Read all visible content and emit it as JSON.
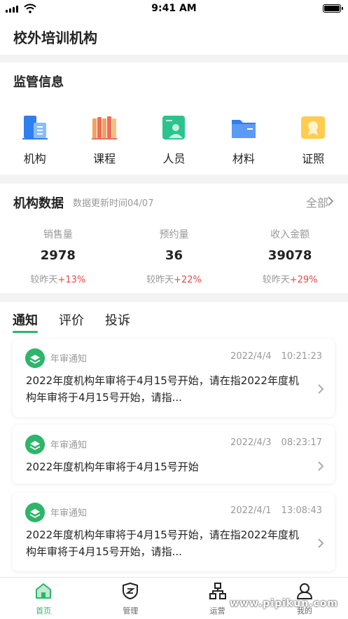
{
  "status_bar": {
    "time": "9:41 AM"
  },
  "header": {
    "title": "校外培训机构"
  },
  "supervision": {
    "title": "监管信息",
    "items": [
      {
        "label": "机构",
        "icon": "building-icon"
      },
      {
        "label": "课程",
        "icon": "books-icon"
      },
      {
        "label": "人员",
        "icon": "person-card-icon"
      },
      {
        "label": "材料",
        "icon": "folder-icon"
      },
      {
        "label": "证照",
        "icon": "certificate-icon"
      }
    ]
  },
  "data": {
    "title": "机构数据",
    "updated": "数据更新时间04/07",
    "all_label": "全部",
    "stats": [
      {
        "label": "销售量",
        "value": "2978",
        "compare": "较昨天",
        "delta": "+13%"
      },
      {
        "label": "预约量",
        "value": "36",
        "compare": "较昨天",
        "delta": "+22%"
      },
      {
        "label": "收入金额",
        "value": "39078",
        "compare": "较昨天",
        "delta": "+29%"
      }
    ]
  },
  "notices": {
    "tabs": [
      {
        "label": "通知"
      },
      {
        "label": "评价"
      },
      {
        "label": "投诉"
      }
    ],
    "items": [
      {
        "type": "年审通知",
        "date": "2022/4/4 10:21:23",
        "text": "2022年度机构年审将于4月15号开始，请在指2022年度机构年审将于4月15号开始，请指..."
      },
      {
        "type": "年审通知",
        "date": "2022/4/3 08:23:17",
        "text": "2022年度机构年审将于4月15号开始"
      },
      {
        "type": "年审通知",
        "date": "2022/4/1 13:08:43",
        "text": "2022年度机构年审将于4月15号开始，请在指2022年度机构年审将于4月15号开始，请指..."
      }
    ]
  },
  "tabbar": {
    "items": [
      {
        "label": "首页",
        "icon": "home-icon",
        "active": true
      },
      {
        "label": "管理",
        "icon": "shield-icon"
      },
      {
        "label": "运营",
        "icon": "org-chart-icon"
      },
      {
        "label": "我的",
        "icon": "user-icon"
      }
    ]
  },
  "watermark": "www.pipikun.com",
  "colors": {
    "accent": "#2eb56b",
    "delta_up": "#e8484a",
    "muted_text": "#999999"
  }
}
